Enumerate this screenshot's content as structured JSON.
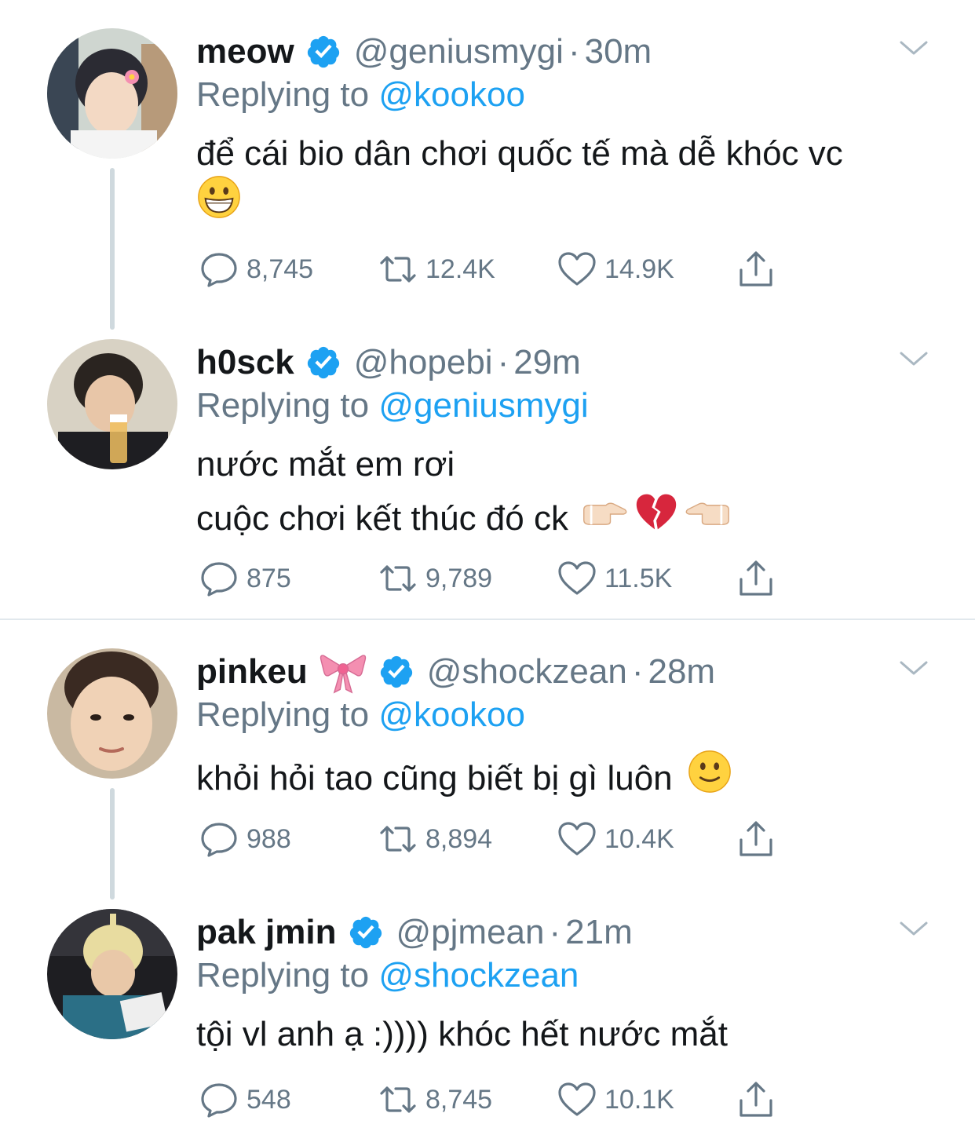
{
  "colors": {
    "link": "#1da1f2",
    "secondary_text": "#657786",
    "primary_text": "#14171a",
    "verified": "#1da1f2",
    "thread_line": "#cfd9de"
  },
  "tweets": [
    {
      "name": "meow",
      "handle": "@geniusmygi",
      "separator": "·",
      "time": "30m",
      "replying_prefix": "Replying to",
      "replying_to": "@kookoo",
      "body_lines": [
        "để cái bio dân chơi quốc tế mà dễ khóc vc"
      ],
      "trailing_emoji": "grinning-face",
      "replies": "8,745",
      "retweets": "12.4K",
      "likes": "14.9K",
      "verified": true
    },
    {
      "name": "h0sck",
      "handle": "@hopebi",
      "separator": "·",
      "time": "29m",
      "replying_prefix": "Replying to",
      "replying_to": "@geniusmygi",
      "body_lines": [
        "nước mắt em rơi",
        "cuộc chơi kết thúc đó ck"
      ],
      "trailing_emoji": "pointing-right broken-heart pointing-left",
      "replies": "875",
      "retweets": "9,789",
      "likes": "11.5K",
      "verified": true
    },
    {
      "name": "pinkeu",
      "name_emoji": "ribbon",
      "handle": "@shockzean",
      "separator": "·",
      "time": "28m",
      "replying_prefix": "Replying to",
      "replying_to": "@kookoo",
      "body_lines": [
        "khỏi hỏi tao cũng biết bị gì luôn"
      ],
      "trailing_emoji": "slightly-smiling-face",
      "replies": "988",
      "retweets": "8,894",
      "likes": "10.4K",
      "verified": true
    },
    {
      "name": "pak jmin",
      "handle": "@pjmean",
      "separator": "·",
      "time": "21m",
      "replying_prefix": "Replying to",
      "replying_to": "@shockzean",
      "body_lines": [
        "tội vl anh ạ :)))) khóc hết nước mắt"
      ],
      "replies": "548",
      "retweets": "8,745",
      "likes": "10.1K",
      "verified": true
    }
  ]
}
